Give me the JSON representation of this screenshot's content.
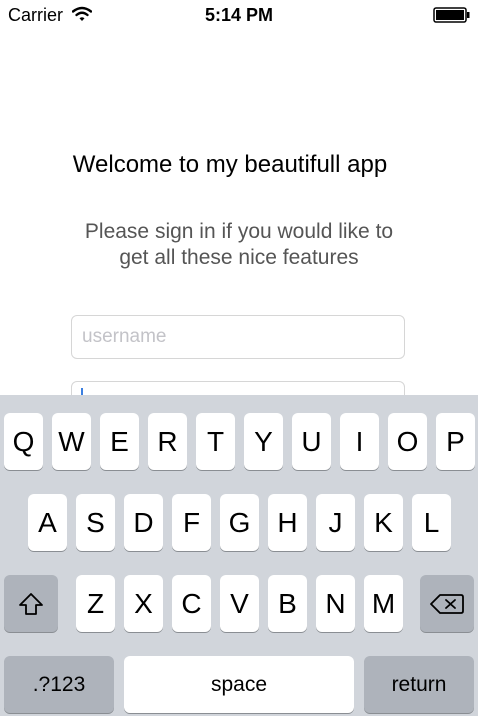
{
  "status_bar": {
    "carrier": "Carrier",
    "time": "5:14 PM",
    "wifi_icon": "wifi-icon",
    "battery_icon": "battery-icon"
  },
  "screen": {
    "title": "Welcome to my beautifull app",
    "message_line1": "Please sign in if you would like to",
    "message_line2": "get all these nice features"
  },
  "form": {
    "username_placeholder": "username",
    "username_value": "",
    "password_value": ""
  },
  "keyboard": {
    "rows": [
      [
        "Q",
        "W",
        "E",
        "R",
        "T",
        "Y",
        "U",
        "I",
        "O",
        "P"
      ],
      [
        "A",
        "S",
        "D",
        "F",
        "G",
        "H",
        "J",
        "K",
        "L"
      ],
      [
        "Z",
        "X",
        "C",
        "V",
        "B",
        "N",
        "M"
      ]
    ],
    "shift_icon": "shift-icon",
    "delete_icon": "delete-icon",
    "numbers_label": ".?123",
    "space_label": "space",
    "return_label": "return"
  },
  "colors": {
    "keyboard_background": "#d1d5db",
    "key_light": "#ffffff",
    "key_dark": "#aeb3bb",
    "cursor": "#3b7fe0",
    "message_text": "#555555",
    "placeholder": "#c3c3c8"
  }
}
